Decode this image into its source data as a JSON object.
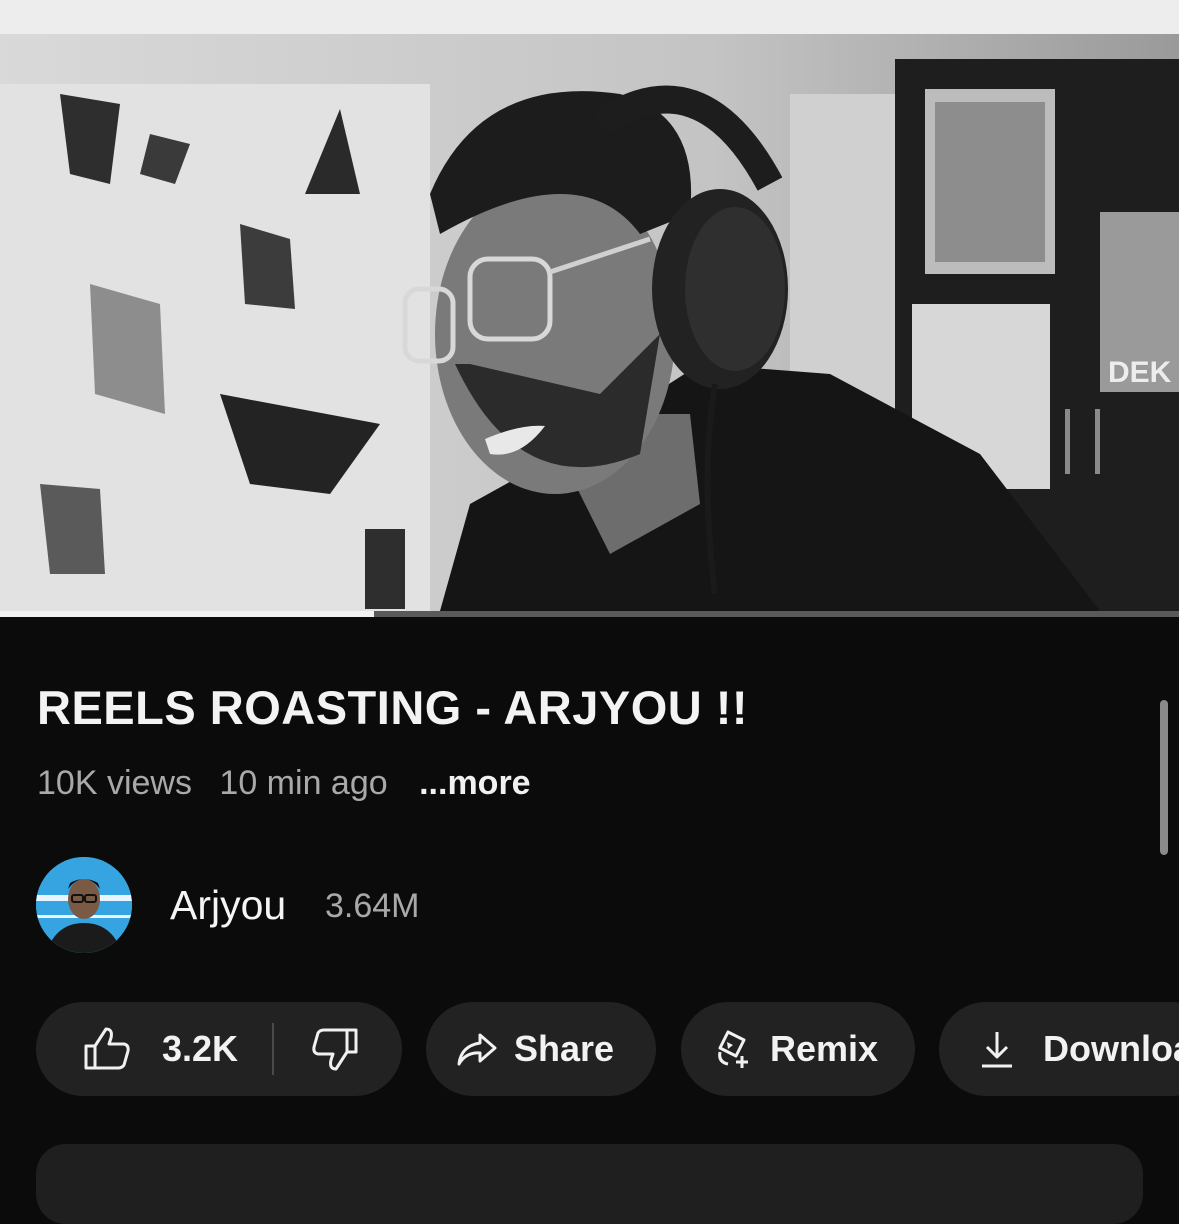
{
  "video": {
    "title": "REELS ROASTING - ARJYOU !!",
    "views": "10K views",
    "time_ago": "10 min ago",
    "more_label": "...more",
    "progress_fraction": 0.317,
    "poster_text": "DEK"
  },
  "channel": {
    "name": "Arjyou",
    "subscribers": "3.64M",
    "avatar_accent": "#35a4e0"
  },
  "actions": {
    "like_count": "3.2K",
    "like_icon": "thumbs-up-icon",
    "dislike_icon": "thumbs-down-icon",
    "share_label": "Share",
    "share_icon": "share-arrow-icon",
    "remix_label": "Remix",
    "remix_icon": "remix-icon",
    "download_label": "Download",
    "download_icon": "download-icon"
  },
  "colors": {
    "background": "#0b0b0b",
    "pill": "#222222",
    "secondary_text": "#a9a9a9"
  }
}
